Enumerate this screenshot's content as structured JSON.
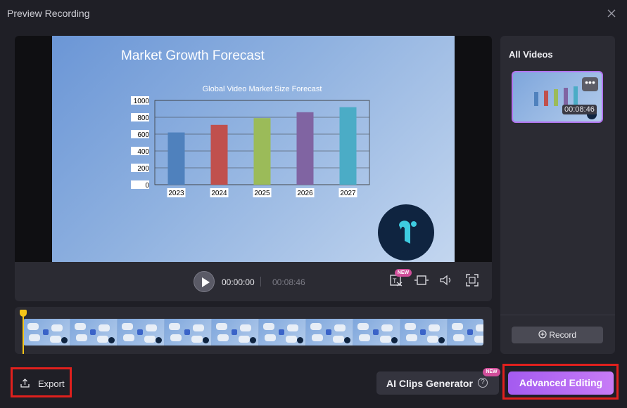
{
  "window": {
    "title": "Preview Recording",
    "close_icon": "close-icon"
  },
  "slide": {
    "title": "Market Growth Forecast",
    "chart_data": {
      "type": "bar",
      "title": "Global Video Market Size Forecast",
      "categories": [
        "2023",
        "2024",
        "2025",
        "2026",
        "2027"
      ],
      "values": [
        620,
        710,
        790,
        860,
        920
      ],
      "colors": [
        "#4f81bd",
        "#c0504d",
        "#9bbb59",
        "#8064a2",
        "#4bacc6"
      ],
      "yticks": [
        "0",
        "200",
        "400",
        "600",
        "800",
        "1000"
      ],
      "ylim": [
        0,
        1000
      ],
      "grid": true
    }
  },
  "player": {
    "current_time": "00:00:00",
    "total_time": "00:08:46",
    "new_badge": "NEW",
    "icons": [
      "play-icon",
      "captions-icon",
      "crop-icon",
      "volume-icon",
      "fullscreen-icon"
    ]
  },
  "sidebar": {
    "title": "All Videos",
    "thumb_duration": "00:08:46",
    "more_label": "•••",
    "record_label": "Record"
  },
  "footer": {
    "export_label": "Export",
    "clips_label": "AI Clips Generator",
    "clips_badge": "NEW",
    "help_label": "?",
    "advanced_label": "Advanced Editing"
  }
}
